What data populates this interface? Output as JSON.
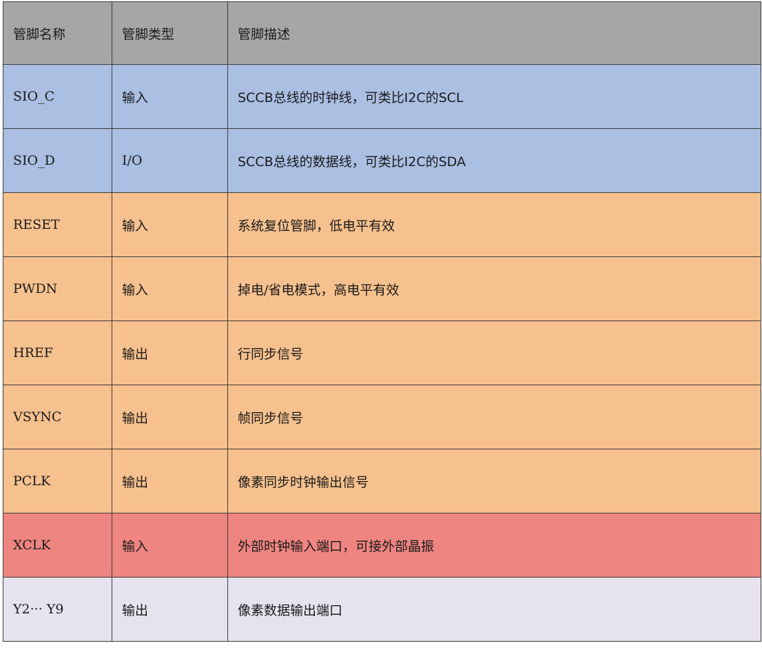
{
  "table": {
    "headers": {
      "name": "管脚名称",
      "type": "管脚类型",
      "desc": "管脚描述"
    },
    "rows": [
      {
        "group": "sccb",
        "name": "SIO_C",
        "type": "输入",
        "desc": "SCCB总线的时钟线，可类比I2C的SCL"
      },
      {
        "group": "sccb",
        "name": "SIO_D",
        "type": "I/O",
        "desc": "SCCB总线的数据线，可类比I2C的SDA"
      },
      {
        "group": "ctrl",
        "name": "RESET",
        "type": "输入",
        "desc": "系统复位管脚，低电平有效"
      },
      {
        "group": "ctrl",
        "name": "PWDN",
        "type": "输入",
        "desc": "掉电/省电模式，高电平有效"
      },
      {
        "group": "ctrl",
        "name": "HREF",
        "type": "输出",
        "desc": "行同步信号"
      },
      {
        "group": "ctrl",
        "name": "VSYNC",
        "type": "输出",
        "desc": "帧同步信号"
      },
      {
        "group": "ctrl",
        "name": "PCLK",
        "type": "输出",
        "desc": "像素同步时钟输出信号"
      },
      {
        "group": "clk",
        "name": "XCLK",
        "type": "输入",
        "desc": "外部时钟输入端口，可接外部晶振"
      },
      {
        "group": "data",
        "name": "Y2··· Y9",
        "type": "输出",
        "desc": "像素数据输出端口"
      }
    ]
  },
  "colors": {
    "header_bg": "#a6a6a6",
    "sccb_bg": "#abbfe2",
    "ctrl_bg": "#f6c18e",
    "clk_bg": "#ee8580",
    "data_bg": "#e7e3ee",
    "border": "#3a3a3a"
  }
}
